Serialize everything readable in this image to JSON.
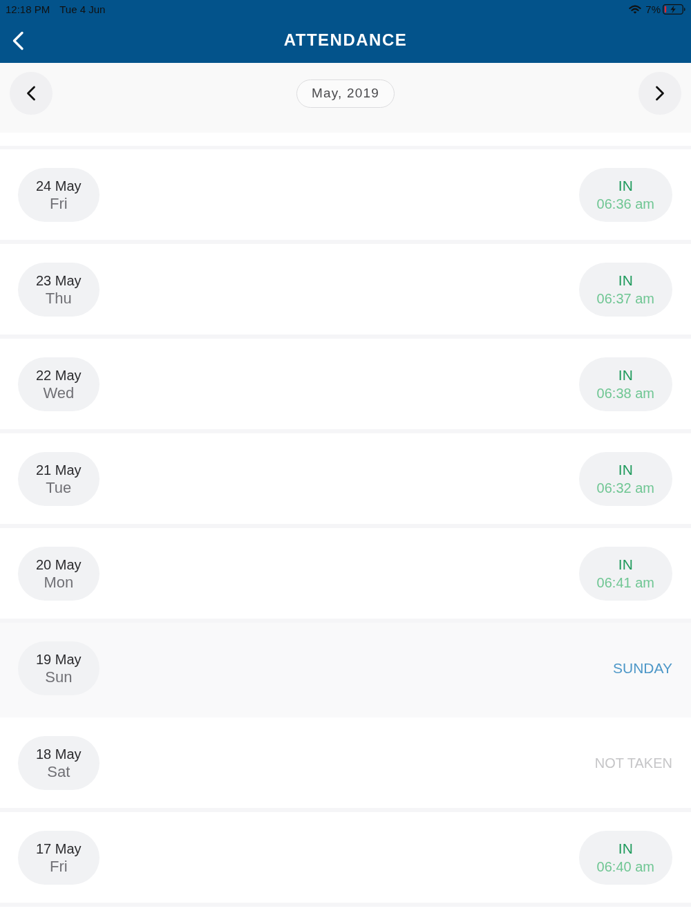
{
  "status_bar": {
    "time": "12:18 PM",
    "date": "Tue 4 Jun",
    "battery": "7%"
  },
  "header": {
    "title": "ATTENDANCE"
  },
  "month_nav": {
    "month": "May, 2019"
  },
  "days": [
    {
      "date": "24 May",
      "weekday": "Fri",
      "kind": "in",
      "status": "IN",
      "time": "06:36 am"
    },
    {
      "date": "23 May",
      "weekday": "Thu",
      "kind": "in",
      "status": "IN",
      "time": "06:37 am"
    },
    {
      "date": "22 May",
      "weekday": "Wed",
      "kind": "in",
      "status": "IN",
      "time": "06:38 am"
    },
    {
      "date": "21 May",
      "weekday": "Tue",
      "kind": "in",
      "status": "IN",
      "time": "06:32 am"
    },
    {
      "date": "20 May",
      "weekday": "Mon",
      "kind": "in",
      "status": "IN",
      "time": "06:41 am"
    },
    {
      "date": "19 May",
      "weekday": "Sun",
      "kind": "holiday",
      "status": "SUNDAY"
    },
    {
      "date": "18 May",
      "weekday": "Sat",
      "kind": "not_taken",
      "status": "NOT TAKEN"
    },
    {
      "date": "17 May",
      "weekday": "Fri",
      "kind": "in",
      "status": "IN",
      "time": "06:40 am"
    }
  ]
}
